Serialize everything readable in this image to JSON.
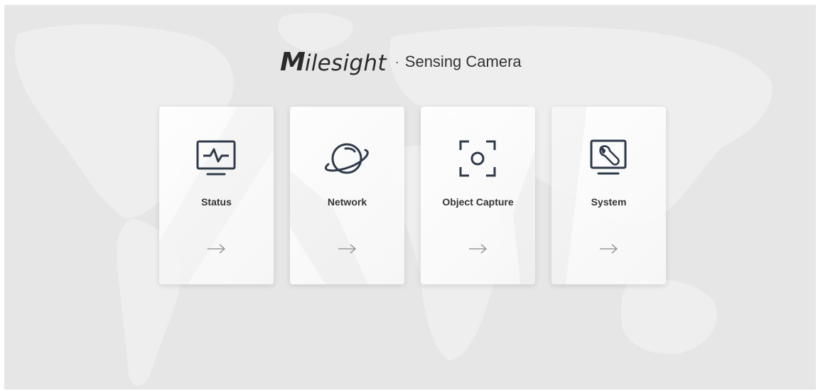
{
  "brand": {
    "logo_first": "M",
    "logo_rest": "ilesight",
    "separator": "·",
    "product": "Sensing Camera"
  },
  "cards": [
    {
      "label": "Status",
      "icon": "status-monitor-icon"
    },
    {
      "label": "Network",
      "icon": "network-planet-icon"
    },
    {
      "label": "Object Capture",
      "icon": "object-capture-icon"
    },
    {
      "label": "System",
      "icon": "system-wrench-icon"
    }
  ],
  "arrow_icon": "arrow-right-icon",
  "colors": {
    "background": "#e6e6e6",
    "card": "#f7f7f7",
    "icon": "#2f3a4a",
    "arrow": "#9a9a9a",
    "text": "#333333"
  }
}
